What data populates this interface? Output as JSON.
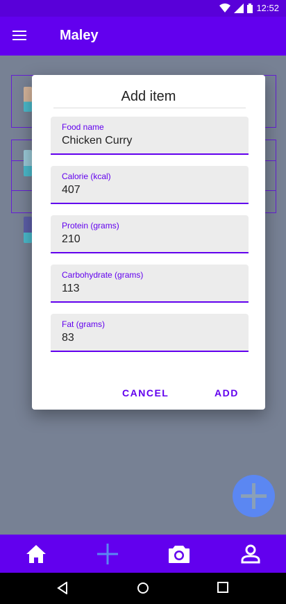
{
  "status": {
    "time": "12:52"
  },
  "app": {
    "title": "Maley"
  },
  "dialog": {
    "title": "Add item",
    "fields": [
      {
        "label": "Food name",
        "value": "Chicken Curry"
      },
      {
        "label": "Calorie (kcal)",
        "value": "407"
      },
      {
        "label": "Protein (grams)",
        "value": "210"
      },
      {
        "label": "Carbohydrate (grams)",
        "value": "113"
      },
      {
        "label": "Fat (grams)",
        "value": "83"
      }
    ],
    "cancel_label": "CANCEL",
    "add_label": "ADD"
  },
  "colors": {
    "primary": "#6200ee",
    "status": "#5900d9",
    "fab": "#5b87f2",
    "field_bg": "#ececec"
  },
  "icons": {
    "menu": "menu-icon",
    "home": "home-icon",
    "add": "plus-icon",
    "camera": "camera-icon",
    "profile": "person-icon"
  }
}
